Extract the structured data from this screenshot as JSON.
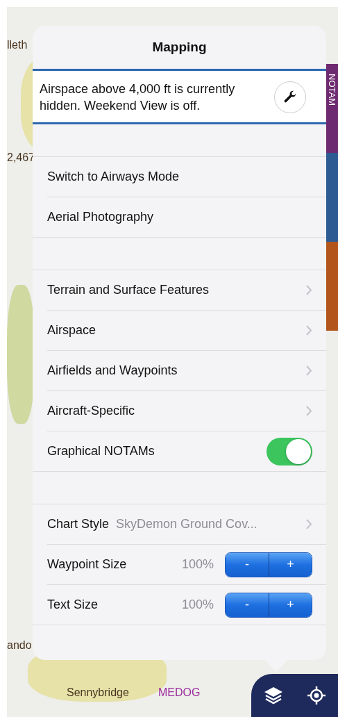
{
  "map": {
    "labels": [
      {
        "text": "lleth",
        "kind": "place"
      },
      {
        "text": "2,467",
        "kind": "place"
      },
      {
        "text": "ando",
        "kind": "place"
      },
      {
        "text": "Sennybridge",
        "kind": "place"
      },
      {
        "text": "MEDOG",
        "kind": "waypoint"
      }
    ]
  },
  "side_tabs": [
    {
      "label": "NOTAM",
      "color": "#6e2a70"
    },
    {
      "color": "#2e5c92"
    },
    {
      "color": "#b2561c"
    }
  ],
  "popover": {
    "title": "Mapping",
    "banner": {
      "text": "Airspace above 4,000 ft is currently hidden. Weekend View is off."
    },
    "sections": [
      [
        {
          "kind": "plain",
          "label": "Switch to Airways Mode"
        },
        {
          "kind": "plain",
          "label": "Aerial Photography"
        }
      ],
      [
        {
          "kind": "link",
          "label": "Terrain and Surface Features"
        },
        {
          "kind": "link",
          "label": "Airspace"
        },
        {
          "kind": "link",
          "label": "Airfields and Waypoints"
        },
        {
          "kind": "link",
          "label": "Aircraft-Specific"
        },
        {
          "kind": "toggle",
          "label": "Graphical NOTAMs",
          "on": true
        }
      ],
      [
        {
          "kind": "value_link",
          "label": "Chart Style",
          "value": "SkyDemon Ground Cov..."
        },
        {
          "kind": "stepper",
          "label": "Waypoint Size",
          "value": "100%",
          "minus": "-",
          "plus": "+"
        },
        {
          "kind": "stepper",
          "label": "Text Size",
          "value": "100%",
          "minus": "-",
          "plus": "+"
        }
      ]
    ]
  }
}
